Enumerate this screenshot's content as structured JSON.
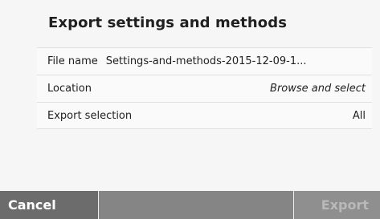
{
  "dialog": {
    "title": "Export settings and methods",
    "rows": [
      {
        "label": "File name",
        "value": "Settings-and-methods-2015-12-09-1..."
      },
      {
        "label": "Location",
        "value": "Browse and select"
      },
      {
        "label": "Export selection",
        "value": "All"
      }
    ]
  },
  "buttons": {
    "cancel_label": "Cancel",
    "export_label": "Export",
    "export_enabled": false
  }
}
